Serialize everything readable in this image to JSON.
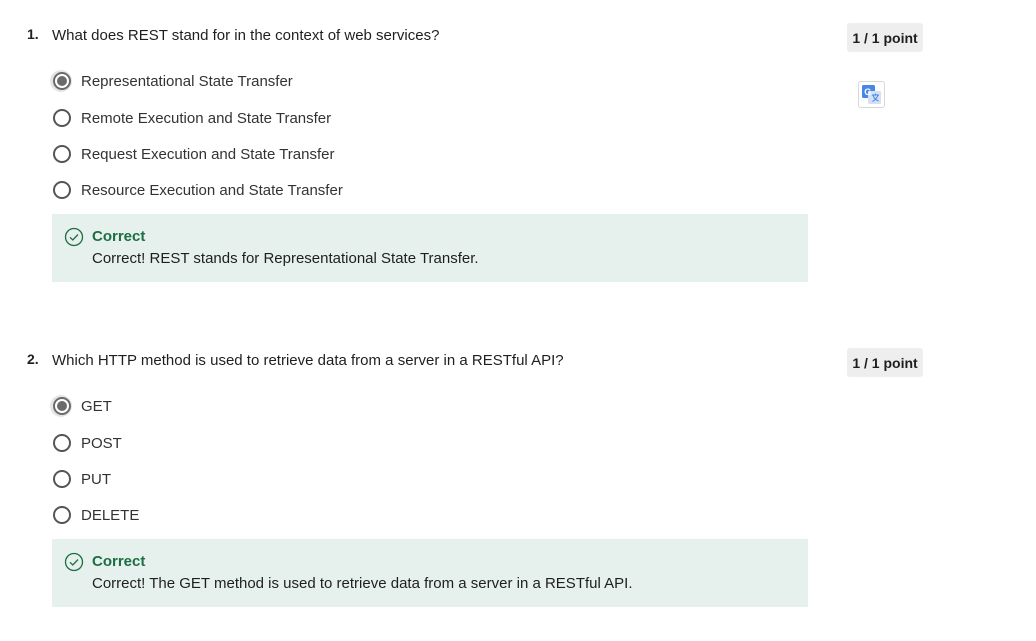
{
  "questions": [
    {
      "number": "1.",
      "text": "What does REST stand for in the context of web services?",
      "points": "1 / 1 point",
      "options": [
        {
          "label": "Representational State Transfer",
          "selected": true
        },
        {
          "label": "Remote Execution and State Transfer",
          "selected": false
        },
        {
          "label": "Request Execution and State Transfer",
          "selected": false
        },
        {
          "label": "Resource Execution and State Transfer",
          "selected": false
        }
      ],
      "feedback": {
        "title": "Correct",
        "text": "Correct! REST stands for Representational State Transfer."
      }
    },
    {
      "number": "2.",
      "text": "Which HTTP method is used to retrieve data from a server in a RESTful API?",
      "points": "1 / 1 point",
      "options": [
        {
          "label": "GET",
          "selected": true
        },
        {
          "label": "POST",
          "selected": false
        },
        {
          "label": "PUT",
          "selected": false
        },
        {
          "label": "DELETE",
          "selected": false
        }
      ],
      "feedback": {
        "title": "Correct",
        "text": "Correct! The GET method is used to retrieve data from a server in a RESTful API."
      }
    }
  ],
  "icons": {
    "translate": "google-translate-icon",
    "correct": "check-circle-icon"
  },
  "colors": {
    "feedback_bg": "#e6f0ec",
    "correct_green": "#1e6e45",
    "badge_bg": "#eeeeee",
    "translate_blue": "#4a86e8"
  }
}
